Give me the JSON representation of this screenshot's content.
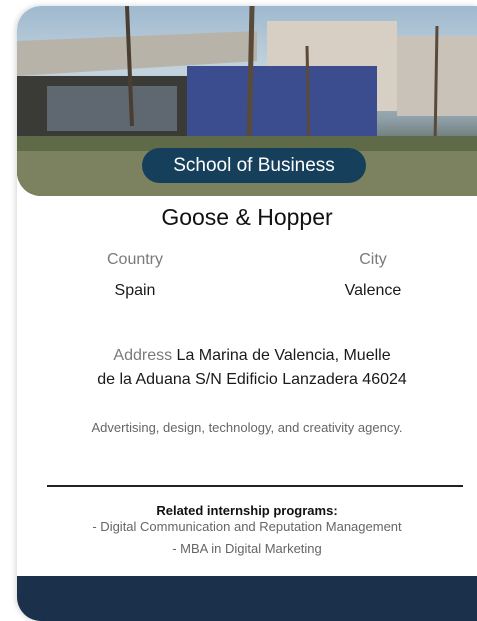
{
  "card": {
    "badge": "School of Business",
    "name": "Goose & Hopper",
    "country_label": "Country",
    "country_value": "Spain",
    "city_label": "City",
    "city_value": "Valence",
    "address_label": "Address",
    "address_value_line1": "La Marina de Valencia, Muelle",
    "address_value_line2": "de la Aduana S/N Edificio Lanzadera 46024",
    "description": "Advertising, design, technology, and creativity agency.",
    "related_title": "Related internship programs:",
    "programs": [
      "- Digital Communication and Reputation Management",
      "- MBA in Digital Marketing"
    ]
  },
  "colors": {
    "badge_bg": "#163f5c",
    "footer_bg": "#1a304b"
  }
}
